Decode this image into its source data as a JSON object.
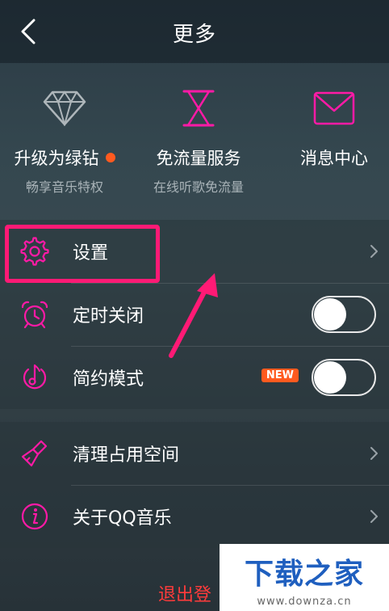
{
  "header": {
    "title": "更多"
  },
  "features": [
    {
      "title": "升级为绿钻",
      "subtitle": "畅享音乐特权",
      "icon": "diamond-icon",
      "dot": true
    },
    {
      "title": "免流量服务",
      "subtitle": "在线听歌免流量",
      "icon": "hourglass-icon",
      "dot": false
    },
    {
      "title": "消息中心",
      "subtitle": "",
      "icon": "mail-icon",
      "dot": false
    }
  ],
  "settings_group": {
    "settings": {
      "label": "设置",
      "icon": "gear-icon"
    },
    "timer_off": {
      "label": "定时关闭",
      "icon": "alarm-clock-icon",
      "toggle": false
    },
    "simple_mode": {
      "label": "简约模式",
      "icon": "music-note-icon",
      "toggle": false,
      "badge": "NEW"
    }
  },
  "misc_group": {
    "clean_space": {
      "label": "清理占用空间",
      "icon": "broom-icon"
    },
    "about": {
      "label": "关于QQ音乐",
      "icon": "info-icon"
    }
  },
  "logout": {
    "label": "退出登"
  },
  "watermark": {
    "main": "下载之家",
    "url": "www.downza.cn"
  },
  "colors": {
    "accent": "#ff1aa6",
    "highlight": "#ff1a75",
    "badge": "#ff5a1f"
  }
}
